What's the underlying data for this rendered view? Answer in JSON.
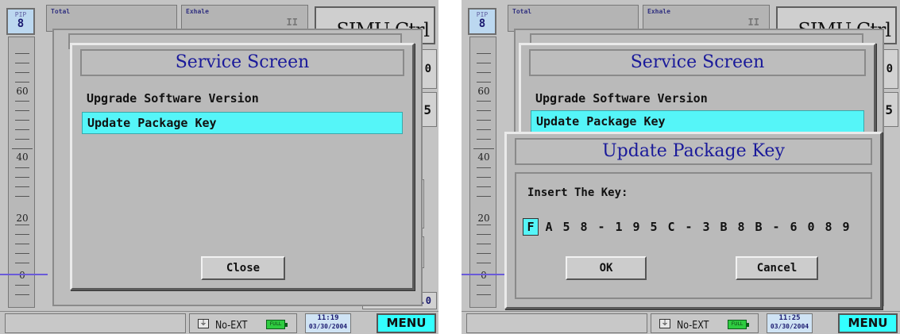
{
  "screens": [
    {
      "pip": {
        "label": "PIP",
        "value": "8"
      },
      "scale": {
        "labels": [
          "60",
          "40",
          "20",
          "0"
        ]
      },
      "header": {
        "total_label": "Total",
        "exhale_label": "Exhale",
        "pause_mark": "II",
        "ctrl_text": "SIMU Ctrl"
      },
      "side_values": {
        "v1": "0",
        "v2": "5",
        "v3": "0.0"
      },
      "status": {
        "no_ext": "No-EXT",
        "battery": "FULL",
        "time": "11:19",
        "date": "03/30/2004",
        "menu": "MENU"
      },
      "service_dialog": {
        "title": "Service Screen",
        "items": [
          "Upgrade Software Version",
          "Update Package Key"
        ],
        "selected_index": 1,
        "close_label": "Close"
      }
    },
    {
      "pip": {
        "label": "PIP",
        "value": "8"
      },
      "scale": {
        "labels": [
          "60",
          "40",
          "20",
          "0"
        ]
      },
      "header": {
        "total_label": "Total",
        "exhale_label": "Exhale",
        "pause_mark": "II",
        "ctrl_text": "SIMU Ctrl"
      },
      "side_values": {
        "v1": "0",
        "v2": "5"
      },
      "status": {
        "no_ext": "No-EXT",
        "battery": "FULL",
        "time": "11:25",
        "date": "03/30/2004",
        "menu": "MENU"
      },
      "service_dialog": {
        "title": "Service Screen",
        "items": [
          "Upgrade Software Version",
          "Update Package Key"
        ],
        "selected_index": 1
      },
      "key_dialog": {
        "title": "Update Package Key",
        "prompt": "Insert The Key:",
        "key_chars": [
          "F",
          "A",
          "5",
          "8",
          "-",
          "1",
          "9",
          "5",
          "C",
          "-",
          "3",
          "B",
          "8",
          "B",
          "-",
          "6",
          "0",
          "8",
          "9"
        ],
        "cursor_index": 0,
        "ok_label": "OK",
        "cancel_label": "Cancel"
      }
    }
  ],
  "colors": {
    "highlight": "#55f5f8",
    "title_blue": "#1a1a9a",
    "menu_button": "#33ffff",
    "battery": "#2ecc40"
  }
}
